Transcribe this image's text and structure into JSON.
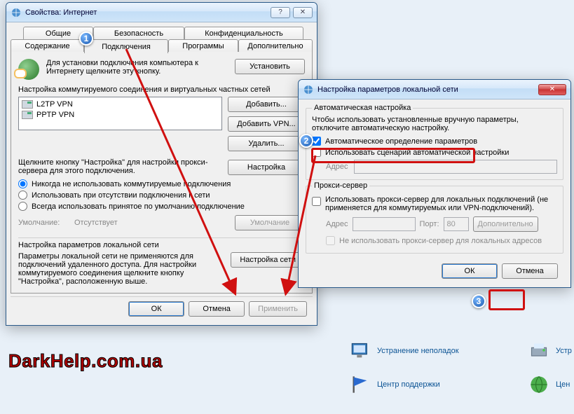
{
  "bg": {
    "troubleshoot": "Устранение неполадок",
    "device": "Устр",
    "support": "Центр поддержки",
    "center": "Цен"
  },
  "win1": {
    "title": "Свойства: Интернет",
    "tabs": {
      "general": "Общие",
      "security": "Безопасность",
      "privacy": "Конфиденциальность",
      "content": "Содержание",
      "connections": "Подключения",
      "programs": "Программы",
      "advanced": "Дополнительно"
    },
    "setup_text": "Для установки подключения компьютера к Интернету щелкните эту кнопку.",
    "setup_btn": "Установить",
    "dialup_label": "Настройка коммутируемого соединения и виртуальных частных сетей",
    "vpn_items": [
      "L2TP VPN",
      "PPTP VPN"
    ],
    "add_btn": "Добавить...",
    "add_vpn_btn": "Добавить VPN...",
    "remove_btn": "Удалить...",
    "settings_hint": "Щелкните кнопку \"Настройка\" для настройки прокси-сервера для этого подключения.",
    "settings_btn": "Настройка",
    "radio_never": "Никогда не использовать коммутируемые подключения",
    "radio_nonet": "Использовать при отсутствии подключения к сети",
    "radio_always": "Всегда использовать принятое по умолчанию подключение",
    "default_label": "Умолчание:",
    "default_value": "Отсутствует",
    "default_btn": "Умолчание",
    "lan_label": "Настройка параметров локальной сети",
    "lan_hint": "Параметры локальной сети не применяются для подключений удаленного доступа. Для настройки коммутируемого соединения щелкните кнопку \"Настройка\", расположенную выше.",
    "lan_btn": "Настройка сети",
    "ok": "ОК",
    "cancel": "Отмена",
    "apply": "Применить"
  },
  "win2": {
    "title": "Настройка параметров локальной сети",
    "auto_group": "Автоматическая настройка",
    "auto_hint": "Чтобы использовать установленные вручную параметры, отключите автоматическую настройку.",
    "auto_detect": "Автоматическое определение параметров",
    "auto_script": "Использовать сценарий автоматической настройки",
    "address_label": "Адрес",
    "proxy_group": "Прокси-сервер",
    "proxy_use": "Использовать прокси-сервер для локальных подключений (не применяется для коммутируемых или VPN-подключений).",
    "port_label": "Порт:",
    "port_value": "80",
    "advanced_btn": "Дополнительно",
    "bypass_local": "Не использовать прокси-сервер для локальных адресов",
    "ok": "ОК",
    "cancel": "Отмена"
  },
  "watermark": "DarkHelp.com.ua",
  "markers": {
    "m1": "1",
    "m2": "2",
    "m3": "3"
  }
}
